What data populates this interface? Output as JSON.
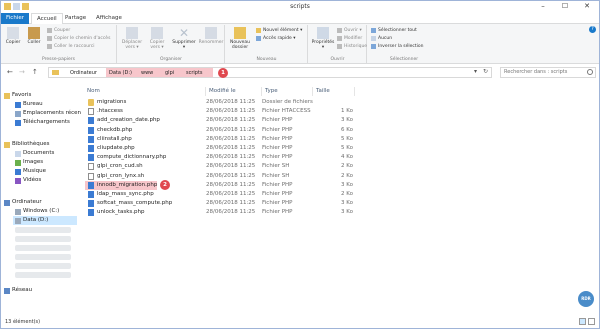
{
  "window": {
    "title": "scripts",
    "minimize": "–",
    "maximize": "☐",
    "close": "✕"
  },
  "tabs": {
    "file": "Fichier",
    "home": "Accueil",
    "share": "Partage",
    "view": "Affichage"
  },
  "ribbon": {
    "clipboard": {
      "label": "Presse-papiers",
      "copy": "Copier",
      "paste": "Coller",
      "cut": "Couper",
      "copy_path": "Copier le chemin d'accès",
      "paste_shortcut": "Coller le raccourci"
    },
    "organize": {
      "label": "Organiser",
      "move_to": "Déplacer vers ▾",
      "copy_to": "Copier vers ▾",
      "delete": "Supprimer ▾",
      "rename": "Renommer"
    },
    "new": {
      "label": "Nouveau",
      "new_folder": "Nouveau dossier",
      "new_item": "Nouvel élément ▾",
      "easy_access": "Accès rapide ▾"
    },
    "open": {
      "label": "Ouvrir",
      "properties": "Propriétés ▾",
      "open": "Ouvrir ▾",
      "modify": "Modifier",
      "history": "Historique"
    },
    "select": {
      "label": "Sélectionner",
      "select_all": "Sélectionner tout",
      "select_none": "Aucun",
      "invert": "Inverser la sélection"
    }
  },
  "address": {
    "path": [
      "Ordinateur",
      "Data (D:)",
      "www",
      "glpi",
      "scripts"
    ],
    "badge": "1",
    "search_placeholder": "Rechercher dans : scripts"
  },
  "nav": {
    "favorites": "Favoris",
    "desktop": "Bureau",
    "recent": "Emplacements récen",
    "downloads": "Téléchargements",
    "libraries": "Bibliothèques",
    "documents": "Documents",
    "images": "Images",
    "music": "Musique",
    "videos": "Vidéos",
    "computer": "Ordinateur",
    "drive_c": "Windows (C:)",
    "drive_d": "Data (D:)",
    "network": "Réseau"
  },
  "columns": {
    "name": "Nom",
    "modified": "Modifié le",
    "type": "Type",
    "size": "Taille"
  },
  "files": [
    {
      "name": "migrations",
      "date": "28/06/2018 11:25",
      "type": "Dossier de fichiers",
      "size": "",
      "icon": "folder"
    },
    {
      "name": ".htaccess",
      "date": "28/06/2018 11:25",
      "type": "Fichier HTACCESS",
      "size": "1 Ko",
      "icon": "doc"
    },
    {
      "name": "add_creation_date.php",
      "date": "28/06/2018 11:25",
      "type": "Fichier PHP",
      "size": "3 Ko",
      "icon": "php"
    },
    {
      "name": "checkdb.php",
      "date": "28/06/2018 11:25",
      "type": "Fichier PHP",
      "size": "6 Ko",
      "icon": "php"
    },
    {
      "name": "cliinstall.php",
      "date": "28/06/2018 11:25",
      "type": "Fichier PHP",
      "size": "5 Ko",
      "icon": "php"
    },
    {
      "name": "cliupdate.php",
      "date": "28/06/2018 11:25",
      "type": "Fichier PHP",
      "size": "5 Ko",
      "icon": "php"
    },
    {
      "name": "compute_dictionnary.php",
      "date": "28/06/2018 11:25",
      "type": "Fichier PHP",
      "size": "4 Ko",
      "icon": "php"
    },
    {
      "name": "glpi_cron_cud.sh",
      "date": "28/06/2018 11:25",
      "type": "Fichier SH",
      "size": "2 Ko",
      "icon": "doc"
    },
    {
      "name": "glpi_cron_lynx.sh",
      "date": "28/06/2018 11:25",
      "type": "Fichier SH",
      "size": "2 Ko",
      "icon": "doc"
    },
    {
      "name": "innodb_migration.php",
      "date": "28/06/2018 11:25",
      "type": "Fichier PHP",
      "size": "3 Ko",
      "icon": "php"
    },
    {
      "name": "ldap_mass_sync.php",
      "date": "28/06/2018 11:25",
      "type": "Fichier PHP",
      "size": "2 Ko",
      "icon": "php"
    },
    {
      "name": "softcat_mass_compute.php",
      "date": "28/06/2018 11:25",
      "type": "Fichier PHP",
      "size": "3 Ko",
      "icon": "php"
    },
    {
      "name": "unlock_tasks.php",
      "date": "28/06/2018 11:25",
      "type": "Fichier PHP",
      "size": "3 Ko",
      "icon": "php"
    }
  ],
  "highlight_badge": "2",
  "status": "13 élément(s)",
  "logo": "RDR",
  "colors": {
    "accent": "#1979ca",
    "highlight": "#f7c6cb",
    "badge": "#e0484f"
  }
}
